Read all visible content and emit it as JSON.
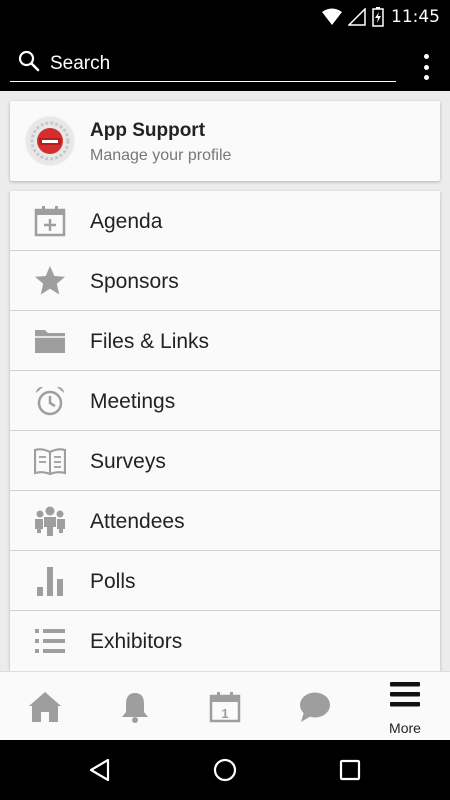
{
  "status_bar": {
    "time": "11:45"
  },
  "search": {
    "placeholder": "Search"
  },
  "profile": {
    "name": "App Support",
    "subtitle": "Manage your profile"
  },
  "menu": {
    "items": [
      {
        "label": "Agenda",
        "icon": "calendar-add-icon"
      },
      {
        "label": "Sponsors",
        "icon": "star-icon"
      },
      {
        "label": "Files & Links",
        "icon": "folder-icon"
      },
      {
        "label": "Meetings",
        "icon": "alarm-clock-icon"
      },
      {
        "label": "Surveys",
        "icon": "open-book-icon"
      },
      {
        "label": "Attendees",
        "icon": "people-icon"
      },
      {
        "label": "Polls",
        "icon": "bar-chart-icon"
      },
      {
        "label": "Exhibitors",
        "icon": "list-icon"
      }
    ]
  },
  "bottom_nav": {
    "calendar_day": "1",
    "more_label": "More"
  },
  "colors": {
    "icon_gray": "#9e9e9e",
    "bar_black": "#000000",
    "card_bg": "#fafafa"
  }
}
